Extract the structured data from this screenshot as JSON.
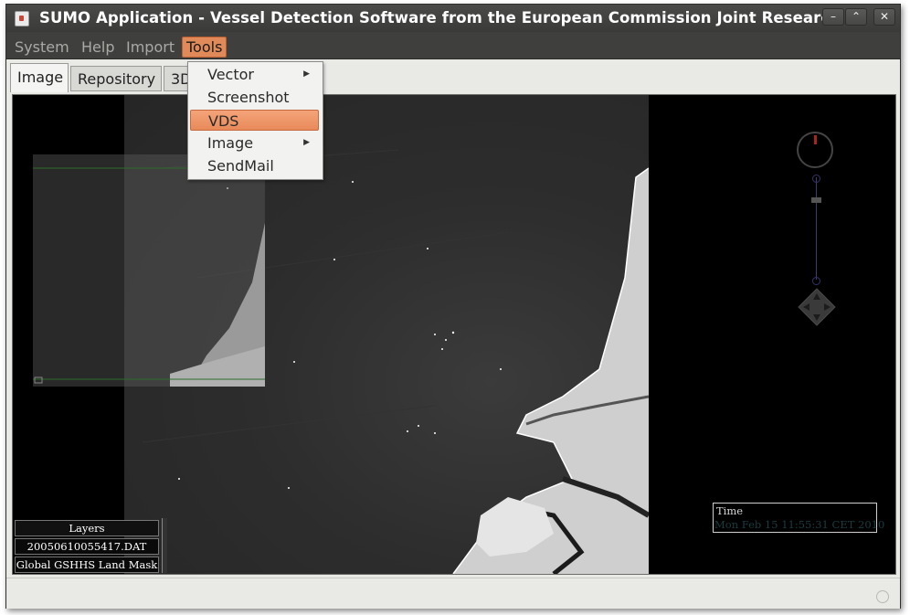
{
  "window": {
    "title": "SUMO Application - Vessel Detection Software from the European Commission Joint Research",
    "buttons": {
      "minimize": "–",
      "maximize": "⌃",
      "close": "✕"
    }
  },
  "menubar": {
    "items": [
      {
        "label": "System"
      },
      {
        "label": "Help"
      },
      {
        "label": "Import"
      },
      {
        "label": "Tools"
      }
    ],
    "active": "Tools"
  },
  "tools_menu": {
    "items": [
      {
        "label": "Vector",
        "submenu": true
      },
      {
        "label": "Screenshot",
        "submenu": false
      },
      {
        "label": "VDS",
        "submenu": false
      },
      {
        "label": "Image",
        "submenu": true
      },
      {
        "label": "SendMail",
        "submenu": false
      }
    ],
    "highlighted": "VDS",
    "submenu_arrow": "▶"
  },
  "tabs": [
    {
      "label": "Image",
      "selected": true
    },
    {
      "label": "Repository",
      "selected": false
    },
    {
      "label": "3D",
      "selected": false
    }
  ],
  "viewer": {
    "layers_panel": {
      "title": "Layers",
      "items": [
        "20050610055417.DAT",
        "Global GSHHS Land Mask"
      ]
    },
    "time_overlay": {
      "label": "Time",
      "value": "Mon Feb 15 11:55:31 CET 2010"
    },
    "navigation_icons": [
      "compass-icon",
      "zoom-slider",
      "pan-pad-icon"
    ]
  },
  "colors": {
    "menu_active": "#e08a5a",
    "titlebar": "#3f3f3d",
    "time_value": "#1a3d40"
  }
}
